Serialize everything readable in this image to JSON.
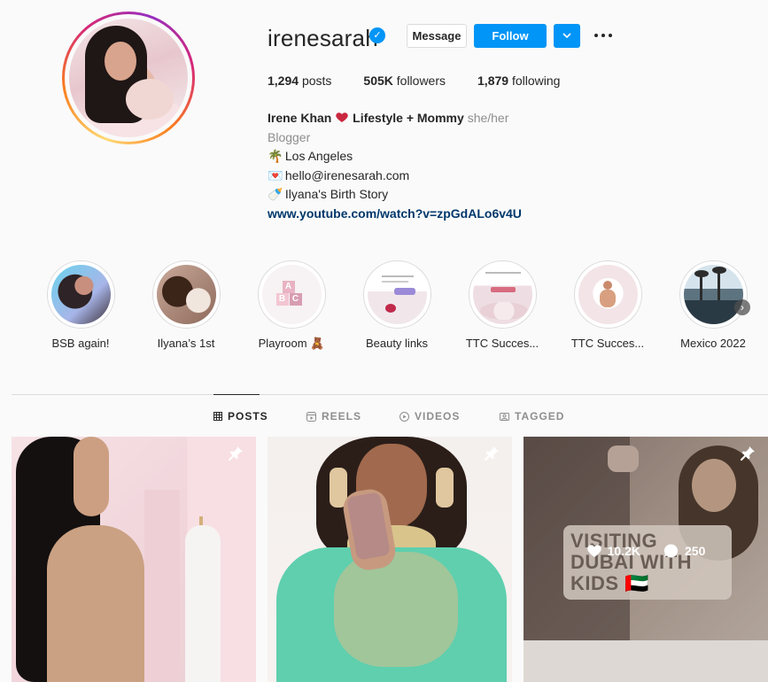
{
  "profile": {
    "username": "irenesarah",
    "verified_badge": "✓",
    "message_label": "Message",
    "follow_label": "Follow",
    "stats": {
      "posts_count": "1,294",
      "posts_label": "posts",
      "followers_count": "505K",
      "followers_label": "followers",
      "following_count": "1,879",
      "following_label": "following"
    },
    "bio": {
      "name": "Irene Khan",
      "tagline": "Lifestyle + Mommy",
      "pronouns": "she/her",
      "category": "Blogger",
      "location_emoji": "🌴",
      "location": "Los Angeles",
      "email_emoji": "💌",
      "email": "hello@irenesarah.com",
      "story_emoji": "🍼",
      "story": "Ilyana's Birth Story",
      "link": "www.youtube.com/watch?v=zpGdALo6v4U"
    }
  },
  "highlights": [
    {
      "label": "BSB again!",
      "icon": "highlight-bsb"
    },
    {
      "label": "Ilyana’s 1st",
      "icon": "highlight-ilyana"
    },
    {
      "label": "Playroom 🧸",
      "icon": "highlight-playroom"
    },
    {
      "label": "Beauty links",
      "icon": "highlight-beauty"
    },
    {
      "label": "TTC Succes...",
      "icon": "highlight-ttc1"
    },
    {
      "label": "TTC Succes...",
      "icon": "highlight-ttc2"
    },
    {
      "label": "Mexico 2022",
      "icon": "highlight-mexico"
    }
  ],
  "tabs": [
    {
      "label": "POSTS",
      "icon": "grid-icon",
      "active": true
    },
    {
      "label": "REELS",
      "icon": "reels-icon",
      "active": false
    },
    {
      "label": "VIDEOS",
      "icon": "video-icon",
      "active": false
    },
    {
      "label": "TAGGED",
      "icon": "tag-icon",
      "active": false
    }
  ],
  "posts": [
    {
      "pinned": true
    },
    {
      "pinned": true
    },
    {
      "pinned": true,
      "overlay_title": "VISITING DUBAI WITH KIDS 🇦🇪",
      "likes": "10.2K",
      "comments": "250"
    }
  ],
  "colors": {
    "accent": "#0095f6",
    "link": "#00376b",
    "muted": "#8e8e8e"
  }
}
